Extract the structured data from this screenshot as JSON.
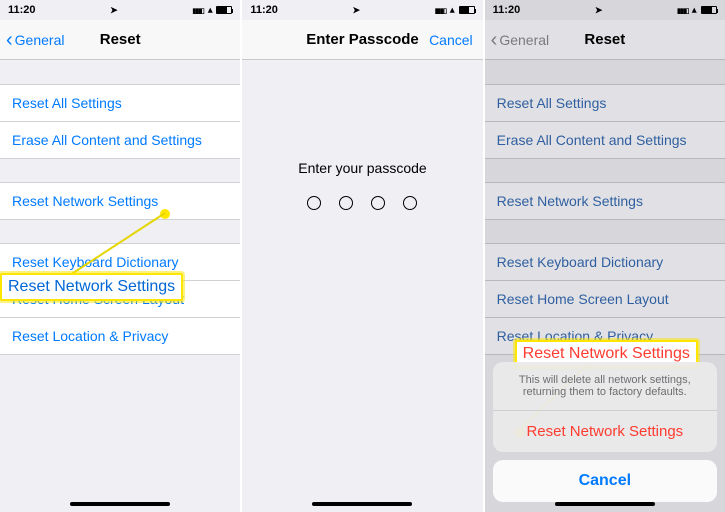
{
  "status": {
    "time": "11:20"
  },
  "screen1": {
    "back": "General",
    "title": "Reset",
    "rows": {
      "all": "Reset All Settings",
      "erase": "Erase All Content and Settings",
      "network": "Reset Network Settings",
      "keyboard": "Reset Keyboard Dictionary",
      "home": "Reset Home Screen Layout",
      "location": "Reset Location & Privacy"
    },
    "callout": "Reset Network Settings"
  },
  "screen2": {
    "title": "Enter Passcode",
    "cancel": "Cancel",
    "prompt": "Enter your passcode"
  },
  "screen3": {
    "back": "General",
    "title": "Reset",
    "rows": {
      "all": "Reset All Settings",
      "erase": "Erase All Content and Settings",
      "network": "Reset Network Settings",
      "keyboard": "Reset Keyboard Dictionary",
      "home": "Reset Home Screen Layout",
      "location": "Reset Location & Privacy"
    },
    "sheet": {
      "message": "This will delete all network settings, returning them to factory defaults.",
      "action": "Reset Network Settings",
      "cancel": "Cancel"
    },
    "callout": "Reset Network Settings"
  }
}
